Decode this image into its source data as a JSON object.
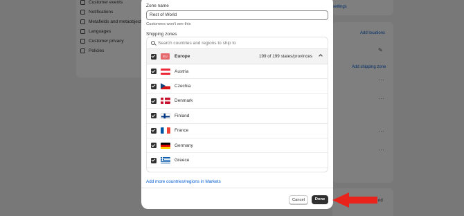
{
  "background": {
    "settings_menu": [
      {
        "label": "Customer events",
        "icon": "customer-events-icon"
      },
      {
        "label": "Notifications",
        "icon": "bell-icon"
      },
      {
        "label": "Metafields and metaobjects",
        "icon": "metafields-icon"
      },
      {
        "label": "Languages",
        "icon": "languages-icon"
      },
      {
        "label": "Customer privacy",
        "icon": "lock-icon"
      },
      {
        "label": "Policies",
        "icon": "policies-icon"
      }
    ],
    "settings_link": "settings",
    "add_locations": "Add locations",
    "add_shipping_zone": "Add shipping zone",
    "trailing_label": "nd"
  },
  "modal": {
    "zone_name_label": "Zone name",
    "zone_name_value": "Rest of World",
    "zone_name_help": "Customers won't see this",
    "shipping_zones_label": "Shipping zones",
    "search_placeholder": "Search countries and regions to ship to",
    "group": {
      "flag_text": "EU",
      "name": "Europe",
      "count": "199 of 199 states/provinces"
    },
    "countries": [
      {
        "name": "Austria",
        "flag": "austria"
      },
      {
        "name": "Czechia",
        "flag": "czechia"
      },
      {
        "name": "Denmark",
        "flag": "denmark"
      },
      {
        "name": "Finland",
        "flag": "finland"
      },
      {
        "name": "France",
        "flag": "france"
      },
      {
        "name": "Germany",
        "flag": "germany"
      },
      {
        "name": "Greece",
        "flag": "greece"
      }
    ],
    "more_link": "Add more countries/regions in Markets",
    "cancel_label": "Cancel",
    "done_label": "Done"
  },
  "colors": {
    "accent": "#005bd3",
    "primary_button": "#303030",
    "annotation_arrow": "#e8231b"
  }
}
